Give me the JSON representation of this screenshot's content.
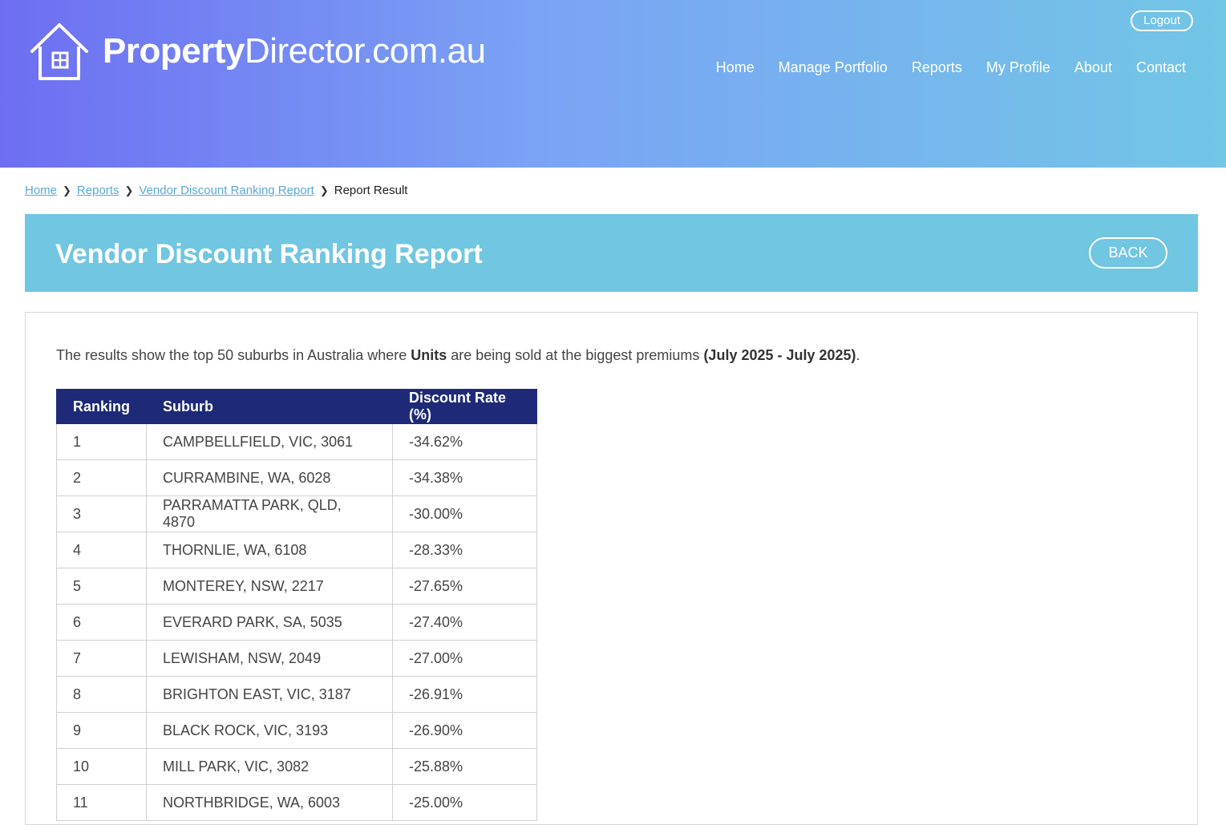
{
  "header": {
    "logo_bold": "Property",
    "logo_light": "Director.com.au",
    "logout_label": "Logout",
    "nav": [
      "Home",
      "Manage Portfolio",
      "Reports",
      "My Profile",
      "About",
      "Contact"
    ]
  },
  "breadcrumb": {
    "items": [
      "Home",
      "Reports",
      "Vendor Discount Ranking Report"
    ],
    "current": "Report Result"
  },
  "report": {
    "title": "Vendor Discount Ranking Report",
    "back_label": "BACK",
    "desc_pre": "The results show the top 50 suburbs in Australia where ",
    "desc_type": "Units",
    "desc_mid": " are being sold at the biggest premiums ",
    "desc_period": "(July 2025 - July 2025)",
    "desc_post": ".",
    "columns": [
      "Ranking",
      "Suburb",
      "Discount Rate (%)"
    ],
    "rows": [
      {
        "rank": "1",
        "suburb": "CAMPBELLFIELD, VIC, 3061",
        "rate": "-34.62%"
      },
      {
        "rank": "2",
        "suburb": "CURRAMBINE, WA, 6028",
        "rate": "-34.38%"
      },
      {
        "rank": "3",
        "suburb": "PARRAMATTA PARK, QLD, 4870",
        "rate": "-30.00%"
      },
      {
        "rank": "4",
        "suburb": "THORNLIE, WA, 6108",
        "rate": "-28.33%"
      },
      {
        "rank": "5",
        "suburb": "MONTEREY, NSW, 2217",
        "rate": "-27.65%"
      },
      {
        "rank": "6",
        "suburb": "EVERARD PARK, SA, 5035",
        "rate": "-27.40%"
      },
      {
        "rank": "7",
        "suburb": "LEWISHAM, NSW, 2049",
        "rate": "-27.00%"
      },
      {
        "rank": "8",
        "suburb": "BRIGHTON EAST, VIC, 3187",
        "rate": "-26.91%"
      },
      {
        "rank": "9",
        "suburb": "BLACK ROCK, VIC, 3193",
        "rate": "-26.90%"
      },
      {
        "rank": "10",
        "suburb": "MILL PARK, VIC, 3082",
        "rate": "-25.88%"
      },
      {
        "rank": "11",
        "suburb": "NORTHBRIDGE, WA, 6003",
        "rate": "-25.00%"
      }
    ]
  },
  "colors": {
    "header_start": "#6e6ef2",
    "header_end": "#72c6e6",
    "title_bar": "#71c6e1",
    "table_header": "#1e2a78",
    "link": "#5aa7d6"
  }
}
